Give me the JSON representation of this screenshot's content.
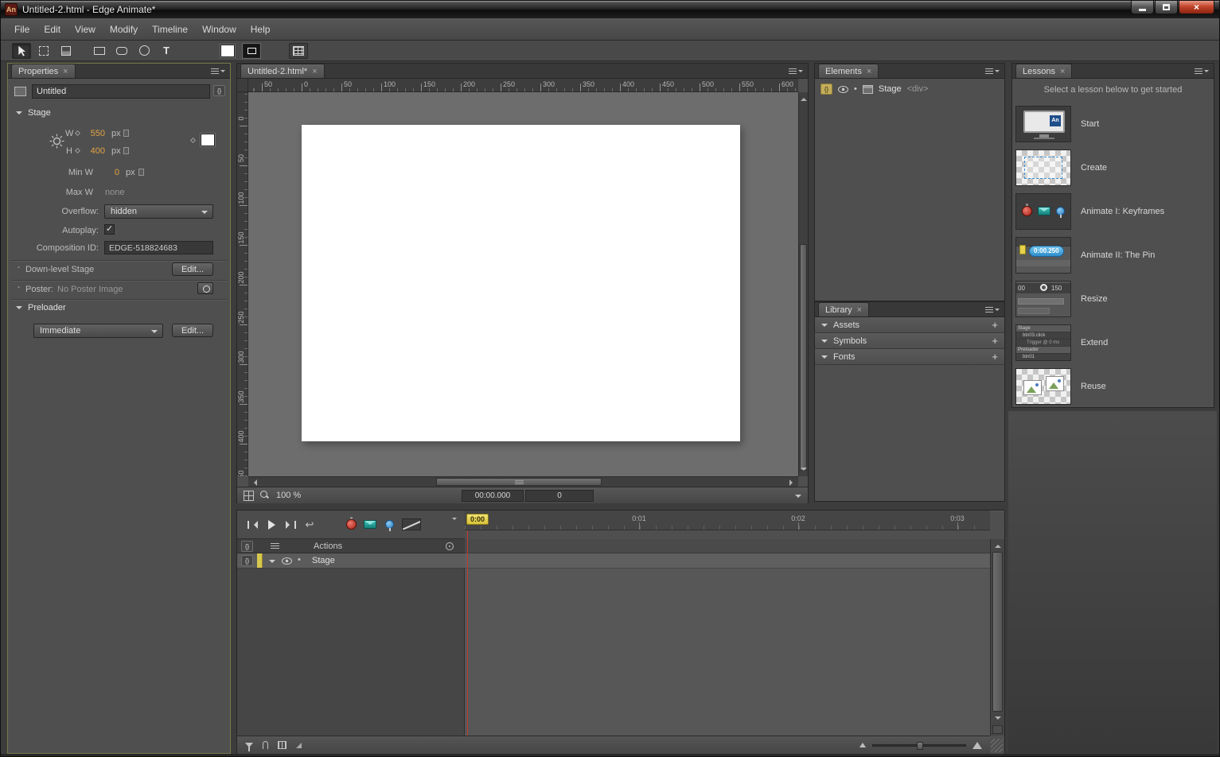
{
  "window": {
    "title": "Untitled-2.html - Edge Animate*",
    "app_initials": "An"
  },
  "menubar": {
    "items": [
      "File",
      "Edit",
      "View",
      "Modify",
      "Timeline",
      "Window",
      "Help"
    ]
  },
  "toolbar": {
    "text_tool_label": "T"
  },
  "properties": {
    "tab_label": "Properties",
    "name_value": "Untitled",
    "stage_section_label": "Stage",
    "w_label": "W",
    "w_value": "550",
    "w_unit": "px",
    "h_label": "H",
    "h_value": "400",
    "h_unit": "px",
    "min_w_label": "Min W",
    "min_w_value": "0",
    "min_w_unit": "px",
    "max_w_label": "Max W",
    "max_w_value": "none",
    "overflow_label": "Overflow:",
    "overflow_value": "hidden",
    "autoplay_label": "Autoplay:",
    "composition_id_label": "Composition ID:",
    "composition_id_value": "EDGE-518824683",
    "downlevel_label": "Down-level Stage",
    "downlevel_edit_label": "Edit...",
    "poster_label": "Poster:",
    "poster_value": "No Poster Image",
    "preloader_section_label": "Preloader",
    "preloader_value": "Immediate",
    "preloader_edit_label": "Edit..."
  },
  "stage": {
    "tab_label": "Untitled-2.html*",
    "h_ruler_labels": [
      "50",
      "0",
      "50",
      "100",
      "150",
      "200",
      "250",
      "300",
      "350",
      "400",
      "450",
      "500",
      "550",
      "600"
    ],
    "v_ruler_labels": [
      "0",
      "50",
      "100",
      "150",
      "200",
      "250",
      "300",
      "350",
      "400",
      "450"
    ],
    "zoom_value": "100 %",
    "time_value": "00:00.000",
    "frame_value": "0"
  },
  "elements": {
    "tab_label": "Elements",
    "rows": [
      {
        "name": "Stage",
        "tag": "<div>"
      }
    ]
  },
  "library": {
    "tab_label": "Library",
    "sections": [
      {
        "label": "Assets"
      },
      {
        "label": "Symbols"
      },
      {
        "label": "Fonts"
      }
    ]
  },
  "lessons": {
    "tab_label": "Lessons",
    "subtitle": "Select a lesson below to get started",
    "items": [
      {
        "label": "Start",
        "thumb": "start"
      },
      {
        "label": "Create",
        "thumb": "create"
      },
      {
        "label": "Animate I: Keyframes",
        "thumb": "keyframes"
      },
      {
        "label": "Animate II: The Pin",
        "thumb": "pin",
        "pin_time": "0:00.250"
      },
      {
        "label": "Resize",
        "thumb": "resize",
        "ruler_left": "00",
        "ruler_right": "150"
      },
      {
        "label": "Extend",
        "thumb": "extend",
        "mini_rows": [
          "Stage",
          "btn03.click",
          "Trigger @ 0 ms",
          "Preloader",
          "btn01"
        ]
      },
      {
        "label": "Reuse",
        "thumb": "reuse"
      }
    ]
  },
  "timeline": {
    "playhead_time": "0:00",
    "ruler_labels": [
      "0:01",
      "0:02",
      "0:03"
    ],
    "actions_header_label": "Actions",
    "rows": [
      {
        "name": "Stage"
      }
    ]
  }
}
